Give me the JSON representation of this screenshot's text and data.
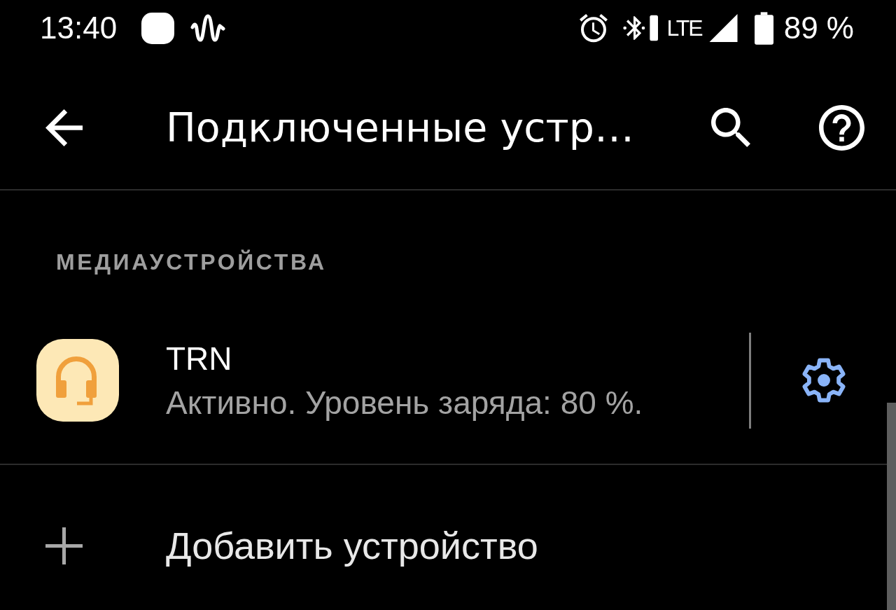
{
  "status_bar": {
    "time": "13:40",
    "network_type": "LTE",
    "battery_percent": "89 %"
  },
  "app_bar": {
    "title": "Подключенные устр…"
  },
  "sections": [
    {
      "header": "МЕДИАУСТРОЙСТВА",
      "devices": [
        {
          "name": "TRN",
          "status": "Активно. Уровень заряда: 80 %."
        }
      ]
    }
  ],
  "add_device": {
    "label": "Добавить устройство"
  }
}
